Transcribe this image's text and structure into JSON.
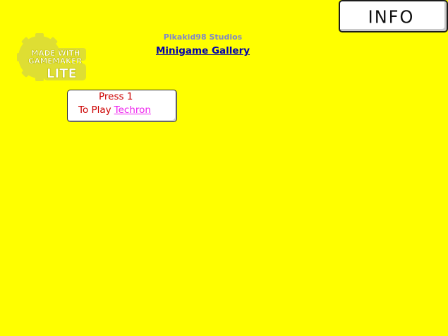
{
  "header": {
    "studio": "Pikakid98 Studios",
    "gallery_title": "Minigame Gallery"
  },
  "info_button": {
    "label": "INFO"
  },
  "logo": {
    "line1": "MADE WITH",
    "line2": "GAMEMAKER",
    "line3": "LITE"
  },
  "game": {
    "press_text": "Press 1",
    "to_play": "To Play",
    "name": "Techron"
  },
  "colors": {
    "background": "#ffff00",
    "studio_text": "#7f87c8",
    "title_text": "#0000aa",
    "prompt_text": "#cc0000",
    "game_link": "#ee22ee",
    "logo_fill": "#dede33"
  }
}
